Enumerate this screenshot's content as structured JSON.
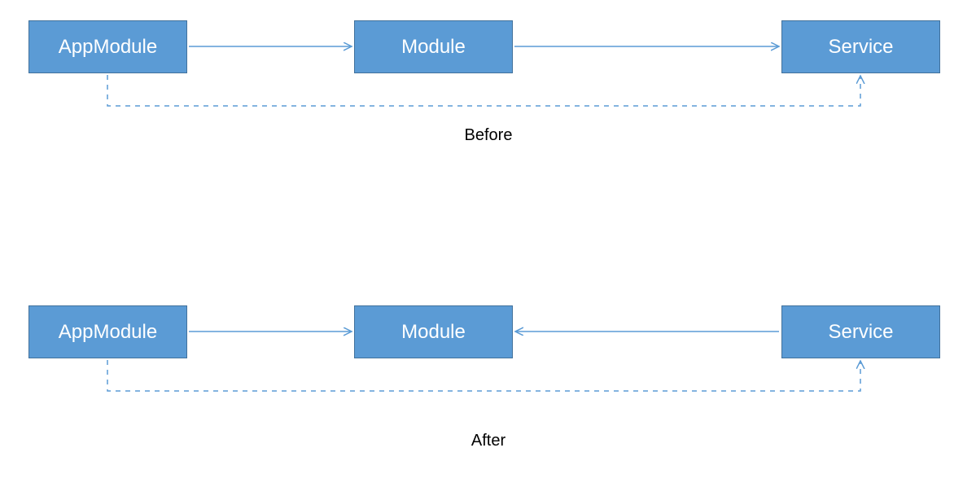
{
  "colors": {
    "boxFill": "#5b9bd5",
    "boxBorder": "#41719c",
    "arrow": "#5b9bd5"
  },
  "before": {
    "caption": "Before",
    "boxes": {
      "app": "AppModule",
      "mod": "Module",
      "svc": "Service"
    },
    "flow": "AppModule -> Module -> Service (dashed AppModule -> Service)"
  },
  "after": {
    "caption": "After",
    "boxes": {
      "app": "AppModule",
      "mod": "Module",
      "svc": "Service"
    },
    "flow": "AppModule -> Module <- Service (dashed AppModule -> Service)"
  }
}
